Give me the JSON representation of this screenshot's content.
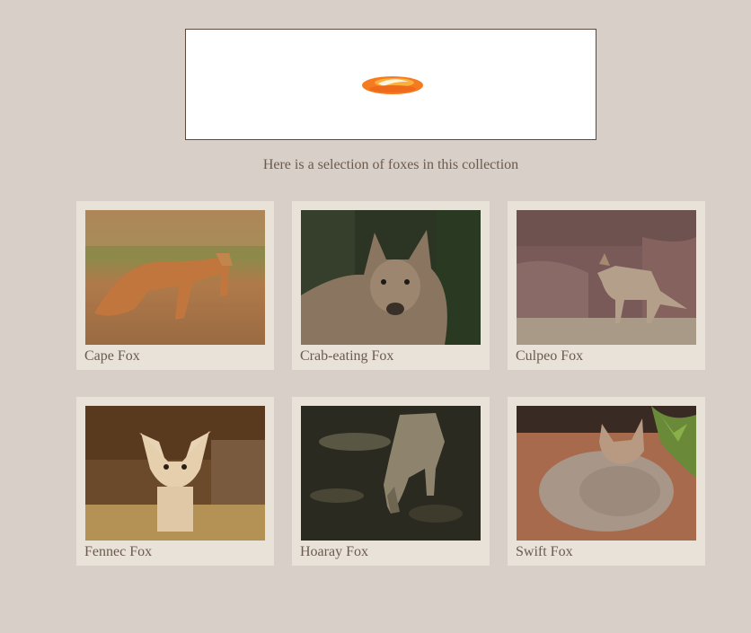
{
  "intro_text": "Here is a selection of foxes in this collection",
  "logo": {
    "icon": "firefox-logo-icon",
    "colors": [
      "#f47b20",
      "#fbb03b"
    ]
  },
  "foxes": [
    {
      "name": "Cape Fox",
      "image": "cape-fox-photo"
    },
    {
      "name": "Crab-eating Fox",
      "image": "crab-eating-fox-photo"
    },
    {
      "name": "Culpeo Fox",
      "image": "culpeo-fox-photo"
    },
    {
      "name": "Fennec Fox",
      "image": "fennec-fox-photo"
    },
    {
      "name": "Hoaray Fox",
      "image": "hoaray-fox-photo"
    },
    {
      "name": "Swift Fox",
      "image": "swift-fox-photo"
    }
  ]
}
